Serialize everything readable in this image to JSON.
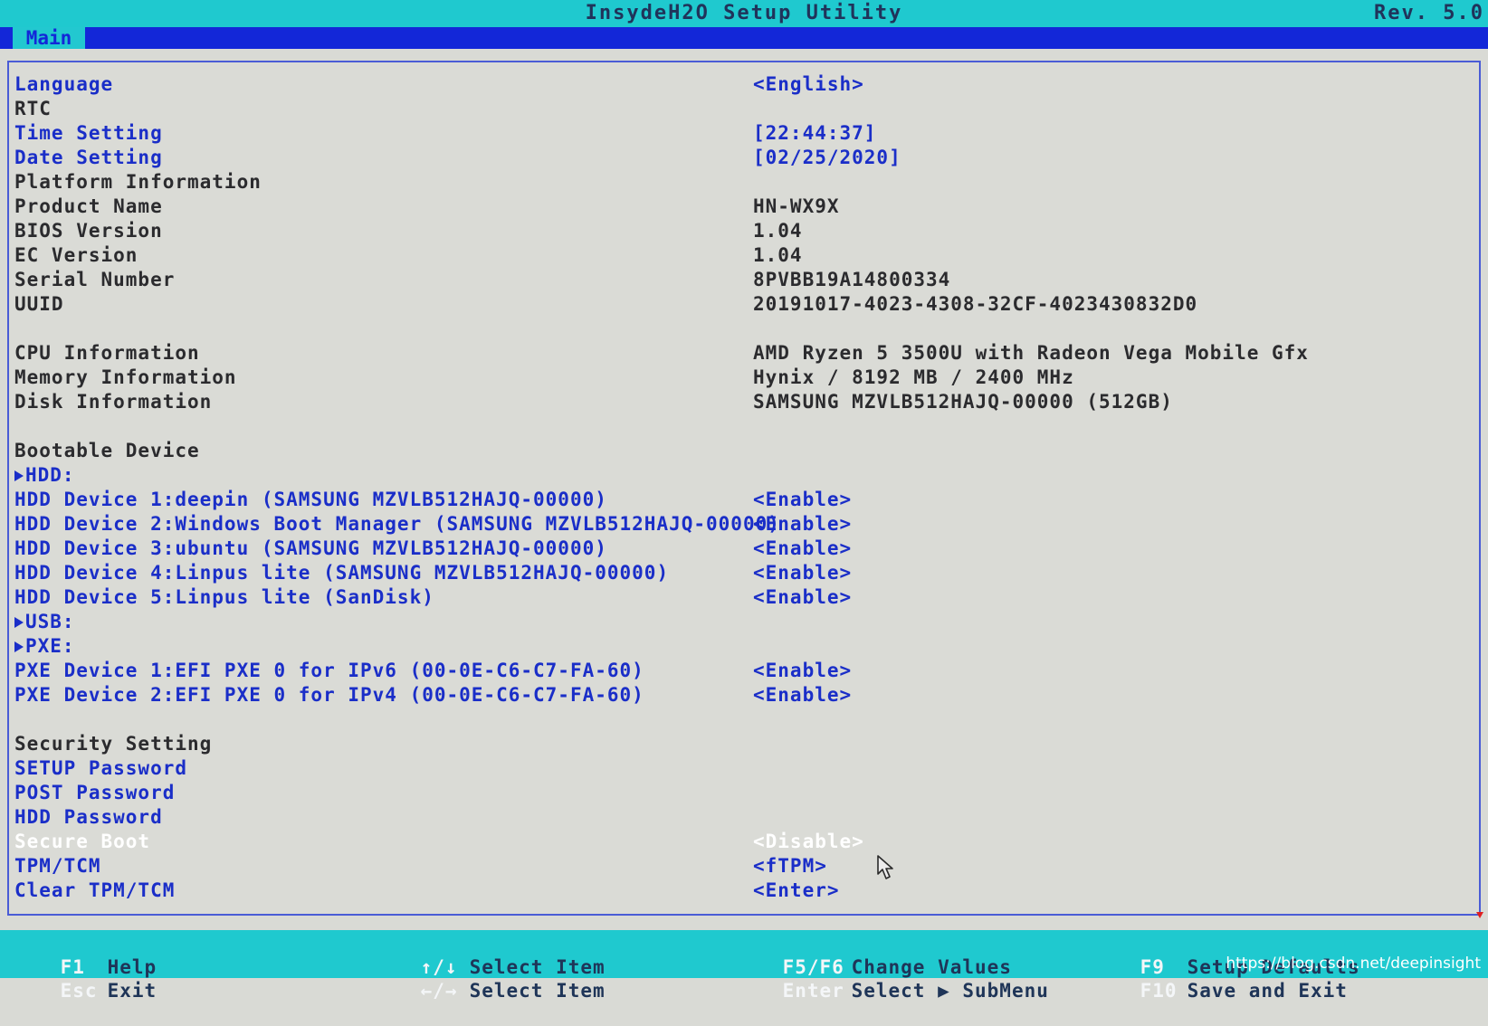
{
  "header": {
    "title": "InsydeH2O Setup Utility",
    "revision": "Rev. 5.0"
  },
  "tabs": [
    {
      "label": "Main"
    }
  ],
  "rows": [
    {
      "label": "Language",
      "value": "<English>"
    },
    {
      "label": "RTC",
      "value": ""
    },
    {
      "label": "Time Setting",
      "value": "[22:44:37]"
    },
    {
      "label": "Date Setting",
      "value": "[02/25/2020]"
    },
    {
      "label": "Platform Information",
      "value": ""
    },
    {
      "label": "Product Name",
      "value": "HN-WX9X"
    },
    {
      "label": "BIOS Version",
      "value": "1.04"
    },
    {
      "label": "EC Version",
      "value": "1.04"
    },
    {
      "label": "Serial Number",
      "value": "8PVBB19A14800334"
    },
    {
      "label": "UUID",
      "value": "20191017-4023-4308-32CF-4023430832D0"
    },
    {
      "label": "CPU Information",
      "value": "AMD Ryzen 5 3500U with Radeon Vega Mobile Gfx"
    },
    {
      "label": "Memory Information",
      "value": "Hynix / 8192 MB / 2400 MHz"
    },
    {
      "label": "Disk Information",
      "value": "SAMSUNG MZVLB512HAJQ-00000 (512GB)"
    },
    {
      "label": "Bootable Device",
      "value": ""
    },
    {
      "label": "HDD:",
      "value": ""
    },
    {
      "label": "HDD Device 1:deepin (SAMSUNG MZVLB512HAJQ-00000)",
      "value": "<Enable>"
    },
    {
      "label": "HDD Device 2:Windows Boot Manager (SAMSUNG MZVLB512HAJQ-00000)",
      "value": "<Enable>"
    },
    {
      "label": "HDD Device 3:ubuntu (SAMSUNG MZVLB512HAJQ-00000)",
      "value": "<Enable>"
    },
    {
      "label": "HDD Device 4:Linpus lite (SAMSUNG MZVLB512HAJQ-00000)",
      "value": "<Enable>"
    },
    {
      "label": "HDD Device 5:Linpus lite (SanDisk)",
      "value": "<Enable>"
    },
    {
      "label": "USB:",
      "value": ""
    },
    {
      "label": "PXE:",
      "value": ""
    },
    {
      "label": "PXE Device 1:EFI PXE 0 for IPv6 (00-0E-C6-C7-FA-60)",
      "value": "<Enable>"
    },
    {
      "label": "PXE Device 2:EFI PXE 0 for IPv4 (00-0E-C6-C7-FA-60)",
      "value": "<Enable>"
    },
    {
      "label": "Security Setting",
      "value": ""
    },
    {
      "label": "SETUP Password",
      "value": ""
    },
    {
      "label": "POST Password",
      "value": ""
    },
    {
      "label": "HDD Password",
      "value": ""
    },
    {
      "label": "Secure Boot",
      "value": "<Disable>"
    },
    {
      "label": "TPM/TCM",
      "value": "<fTPM>"
    },
    {
      "label": "Clear TPM/TCM",
      "value": "<Enter>"
    }
  ],
  "footer": {
    "f1_key": "F1",
    "f1_desc": "Help",
    "esc_key": "Esc",
    "esc_desc": "Exit",
    "updown_key": "↑/↓",
    "updown_desc": "Select Item",
    "leftright_key": "←/→",
    "leftright_desc": "Select Item",
    "f5f6_key": "F5/F6",
    "f5f6_desc": "Change Values",
    "enter_key": "Enter",
    "enter_desc": "Select ▶ SubMenu",
    "f9_key": "F9",
    "f9_desc": "Setup Defaults",
    "f10_key": "F10",
    "f10_desc": "Save and Exit"
  },
  "watermark": "https://blog.csdn.net/deepinsight",
  "colors": {
    "titlebar": "#1fc9cf",
    "tabbar": "#1327d8",
    "selectable_text": "#1a2ec8",
    "info_text": "#2b2b2e",
    "highlight": "#ffffff"
  }
}
